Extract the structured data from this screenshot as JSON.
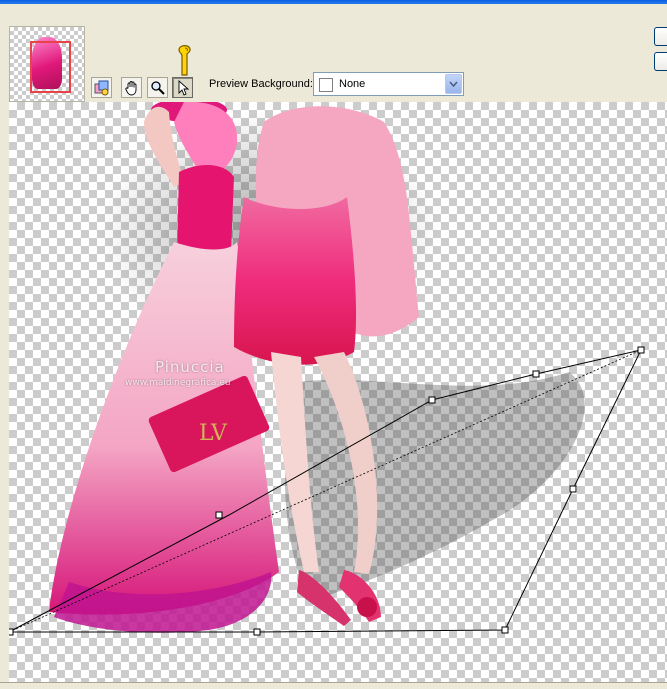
{
  "toolbar": {
    "tools": [
      {
        "name": "navigator-tool",
        "icon": "preview-layers-icon"
      },
      {
        "name": "pan-tool",
        "icon": "hand-icon"
      },
      {
        "name": "zoom-tool",
        "icon": "magnifier-icon"
      },
      {
        "name": "pointer-tool",
        "icon": "arrow-pointer-icon",
        "active": true
      }
    ],
    "preview_background_label": "Preview Background:",
    "preview_background_value": "None"
  },
  "canvas": {
    "watermark_title": "Pinuccia",
    "watermark_url": "www.maidinegrafica.eu",
    "background": "transparent-checkerboard"
  },
  "colors": {
    "accent_pink": "#e0187a",
    "highlight_pink": "#ff4fb3",
    "navigator_frame": "#e8434a",
    "select_border": "#7f9db9"
  }
}
